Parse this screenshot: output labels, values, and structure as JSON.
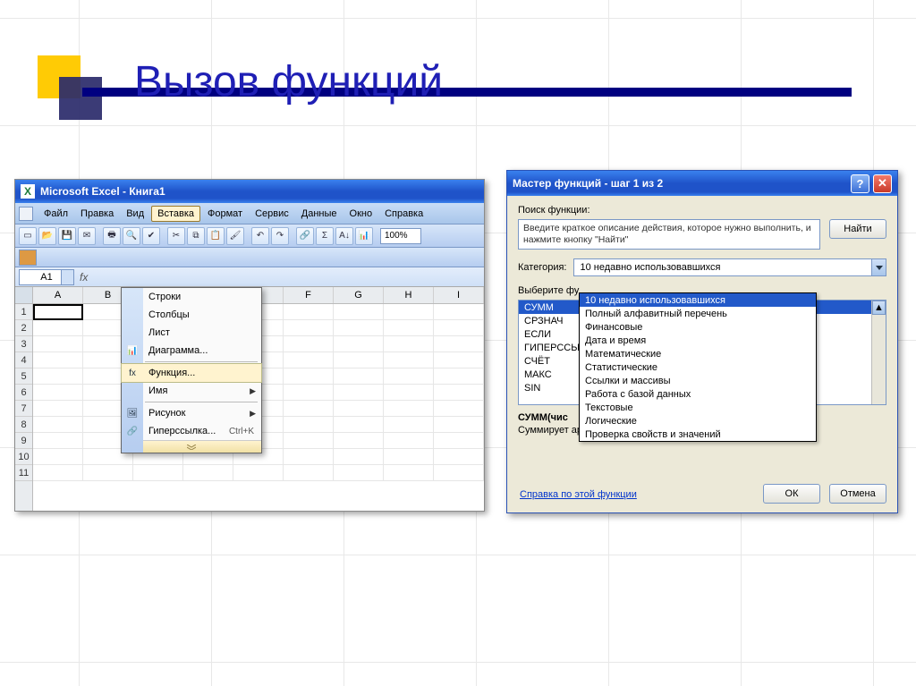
{
  "slide": {
    "title": "Вызов функций"
  },
  "excel": {
    "title": "Microsoft Excel - Книга1",
    "menubar": [
      "Файл",
      "Правка",
      "Вид",
      "Вставка",
      "Формат",
      "Сервис",
      "Данные",
      "Окно",
      "Справка"
    ],
    "menubar_selected": "Вставка",
    "zoom": "100%",
    "namebox": "A1",
    "fx_label": "fx",
    "columns": [
      "A",
      "B",
      "C",
      "D",
      "E",
      "F",
      "G",
      "H",
      "I"
    ],
    "rows": [
      "1",
      "2",
      "3",
      "4",
      "5",
      "6",
      "7",
      "8",
      "9",
      "10",
      "11"
    ],
    "insert_menu": {
      "items": [
        {
          "label": "Строки"
        },
        {
          "label": "Столбцы"
        },
        {
          "label": "Лист"
        },
        {
          "label": "Диаграмма...",
          "icon": "chart"
        },
        {
          "sep": true
        },
        {
          "label": "Функция...",
          "icon": "fx",
          "selected": true
        },
        {
          "label": "Имя",
          "submenu": true
        },
        {
          "sep": true
        },
        {
          "label": "Рисунок",
          "icon": "pic",
          "submenu": true
        },
        {
          "label": "Гиперссылка...",
          "icon": "link",
          "shortcut": "Ctrl+K"
        }
      ]
    }
  },
  "wizard": {
    "title": "Мастер функций - шаг 1 из 2",
    "search_label": "Поиск функции:",
    "search_text": "Введите краткое описание действия, которое нужно выполнить, и нажмите кнопку \"Найти\"",
    "find_btn": "Найти",
    "category_label": "Категория:",
    "category_value": "10 недавно использовавшихся",
    "select_label": "Выберите фу",
    "categories": [
      "10 недавно использовавшихся",
      "Полный алфавитный перечень",
      "Финансовые",
      "Дата и время",
      "Математические",
      "Статистические",
      "Ссылки и массивы",
      "Работа с базой данных",
      "Текстовые",
      "Логические",
      "Проверка свойств и значений"
    ],
    "category_selected_index": 0,
    "functions": [
      "СУММ",
      "СРЗНАЧ",
      "ЕСЛИ",
      "ГИПЕРССЫ",
      "СЧЁТ",
      "МАКС",
      "SIN"
    ],
    "function_selected_index": 0,
    "signature": "СУММ(чис",
    "description": "Суммирует аргументы.",
    "help_link": "Справка по этой функции",
    "ok": "ОК",
    "cancel": "Отмена",
    "help_btn": "?",
    "close_btn": "✕"
  }
}
